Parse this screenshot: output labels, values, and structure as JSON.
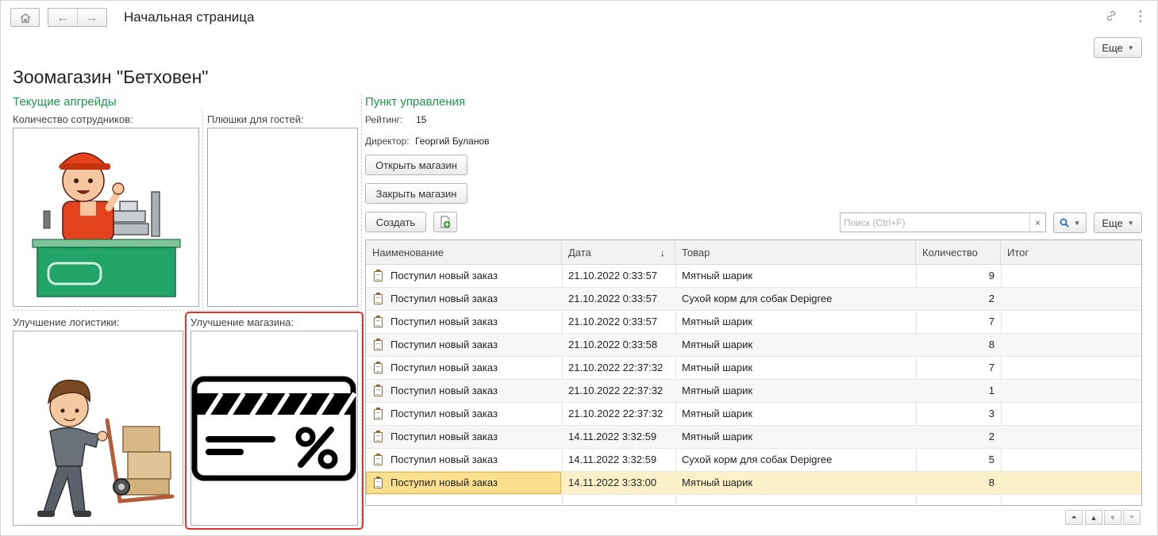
{
  "header": {
    "title": "Начальная страница",
    "more_label": "Еще"
  },
  "shop": {
    "title": "Зоомагазин \"Бетховен\""
  },
  "upgrades": {
    "title": "Текущие апгрейды",
    "staff_label": "Количество сотрудников:",
    "guests_label": "Плюшки для гостей:",
    "logistics_label": "Улучшение логистики:",
    "store_label": "Улучшение магазина:"
  },
  "control": {
    "title": "Пункт управления",
    "rating_label": "Рейтинг:",
    "rating_value": "15",
    "director_label": "Директор:",
    "director_value": "Георгий Буланов",
    "open_button": "Открыть магазин",
    "close_button": "Закрыть магазин"
  },
  "list_toolbar": {
    "create_label": "Создать",
    "search_placeholder": "Поиск (Ctrl+F)",
    "clear_glyph": "×",
    "more_label": "Еще"
  },
  "table": {
    "columns": [
      "Наименование",
      "Дата",
      "Товар",
      "Количество",
      "Итог"
    ],
    "sort_glyph": "↓",
    "rows": [
      {
        "name": "Поступил новый заказ",
        "date": "21.10.2022 0:33:57",
        "good": "Мятный шарик",
        "qty": "9"
      },
      {
        "name": "Поступил новый заказ",
        "date": "21.10.2022 0:33:57",
        "good": "Сухой корм для собак Depigree",
        "qty": "2"
      },
      {
        "name": "Поступил новый заказ",
        "date": "21.10.2022 0:33:57",
        "good": "Мятный шарик",
        "qty": "7"
      },
      {
        "name": "Поступил новый заказ",
        "date": "21.10.2022 0:33:58",
        "good": "Мятный шарик",
        "qty": "8"
      },
      {
        "name": "Поступил новый заказ",
        "date": "21.10.2022 22:37:32",
        "good": "Мятный шарик",
        "qty": "7"
      },
      {
        "name": "Поступил новый заказ",
        "date": "21.10.2022 22:37:32",
        "good": "Мятный шарик",
        "qty": "1"
      },
      {
        "name": "Поступил новый заказ",
        "date": "21.10.2022 22:37:32",
        "good": "Мятный шарик",
        "qty": "3"
      },
      {
        "name": "Поступил новый заказ",
        "date": "14.11.2022 3:32:59",
        "good": "Мятный шарик",
        "qty": "2"
      },
      {
        "name": "Поступил новый заказ",
        "date": "14.11.2022 3:32:59",
        "good": "Сухой корм для собак Depigree",
        "qty": "5"
      },
      {
        "name": "Поступил новый заказ",
        "date": "14.11.2022 3:33:00",
        "good": "Мятный шарик",
        "qty": "8"
      }
    ]
  },
  "icons": {
    "home": "home-icon",
    "back": "arrow-left-icon",
    "forward": "arrow-right-icon",
    "link": "link-icon",
    "menu": "kebab-menu-icon",
    "search": "search-icon",
    "add_copy": "add-document-icon"
  },
  "colors": {
    "group_title": "#1a9a4b",
    "highlight": "#e53030",
    "selected_row": "#fbf0c8"
  }
}
